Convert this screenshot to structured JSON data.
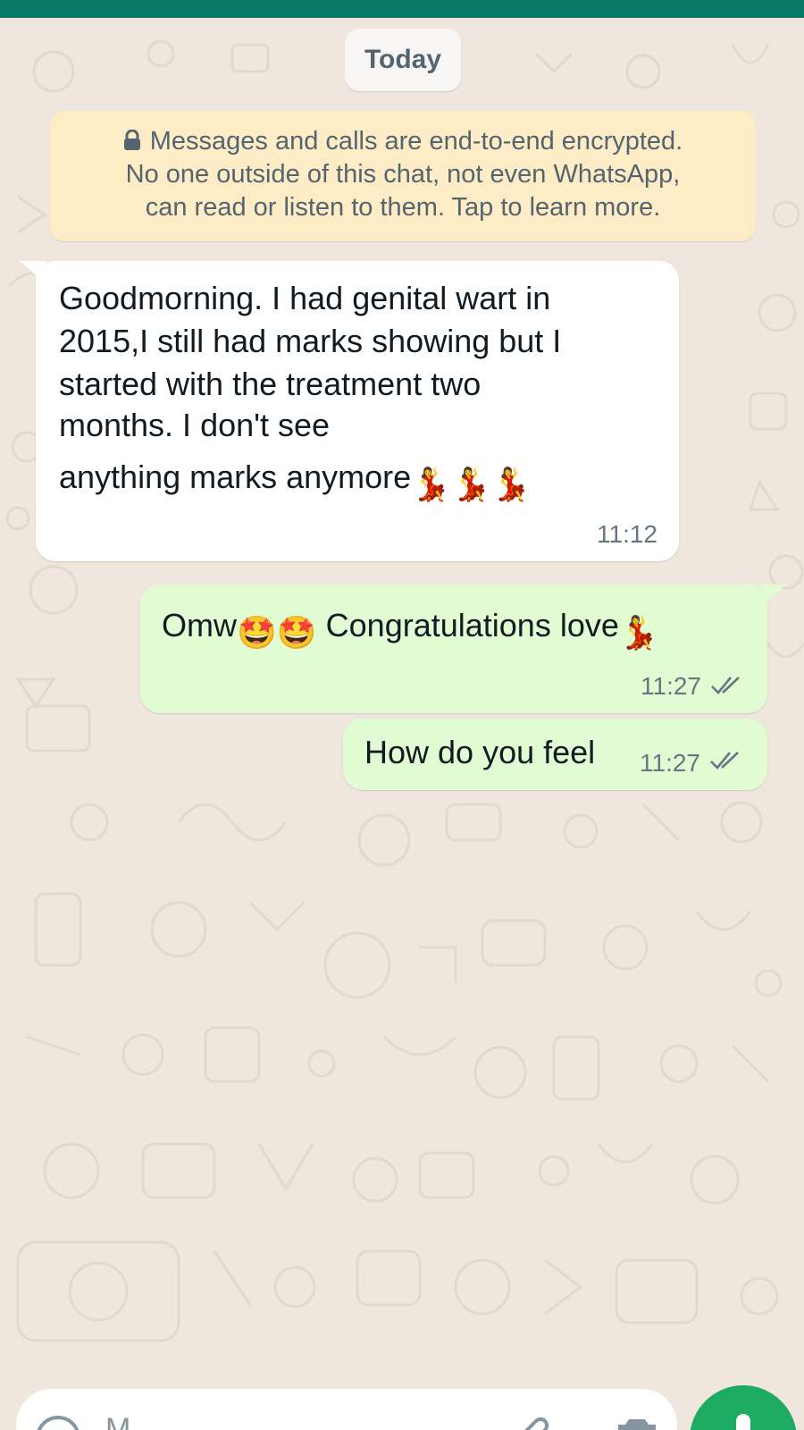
{
  "colors": {
    "header": "#067a65",
    "background": "#efe7de",
    "incoming_bubble": "#ffffff",
    "outgoing_bubble": "#e1fbd3",
    "notice_bg": "#fdecc5",
    "mic_button": "#1daa61"
  },
  "date_divider": "Today",
  "encryption_notice": {
    "line1": "Messages and calls are end-to-end encrypted.",
    "line2": "No one outside of this chat, not even WhatsApp,",
    "line3": "can read or listen to them. Tap to learn more.",
    "icon": "lock-icon"
  },
  "messages": [
    {
      "direction": "incoming",
      "lines": [
        "Goodmorning. I had genital wart in",
        "2015,I still had marks showing  but I",
        "started with the treatment two",
        "months. I don't see",
        " anything marks anymore"
      ],
      "trailing_emoji": "💃💃💃",
      "time": "11:12"
    },
    {
      "direction": "outgoing",
      "text_before": "Omw",
      "emoji_mid": "🤩🤩",
      "text_after": " Congratulations love",
      "trailing_emoji": "💃",
      "time": "11:27",
      "status": "read"
    },
    {
      "direction": "outgoing",
      "text": "How do you feel",
      "time": "11:27",
      "status": "read"
    }
  ],
  "composer": {
    "placeholder": "M",
    "icons": [
      "emoji-icon",
      "attach-icon",
      "camera-icon",
      "mic-icon"
    ]
  }
}
